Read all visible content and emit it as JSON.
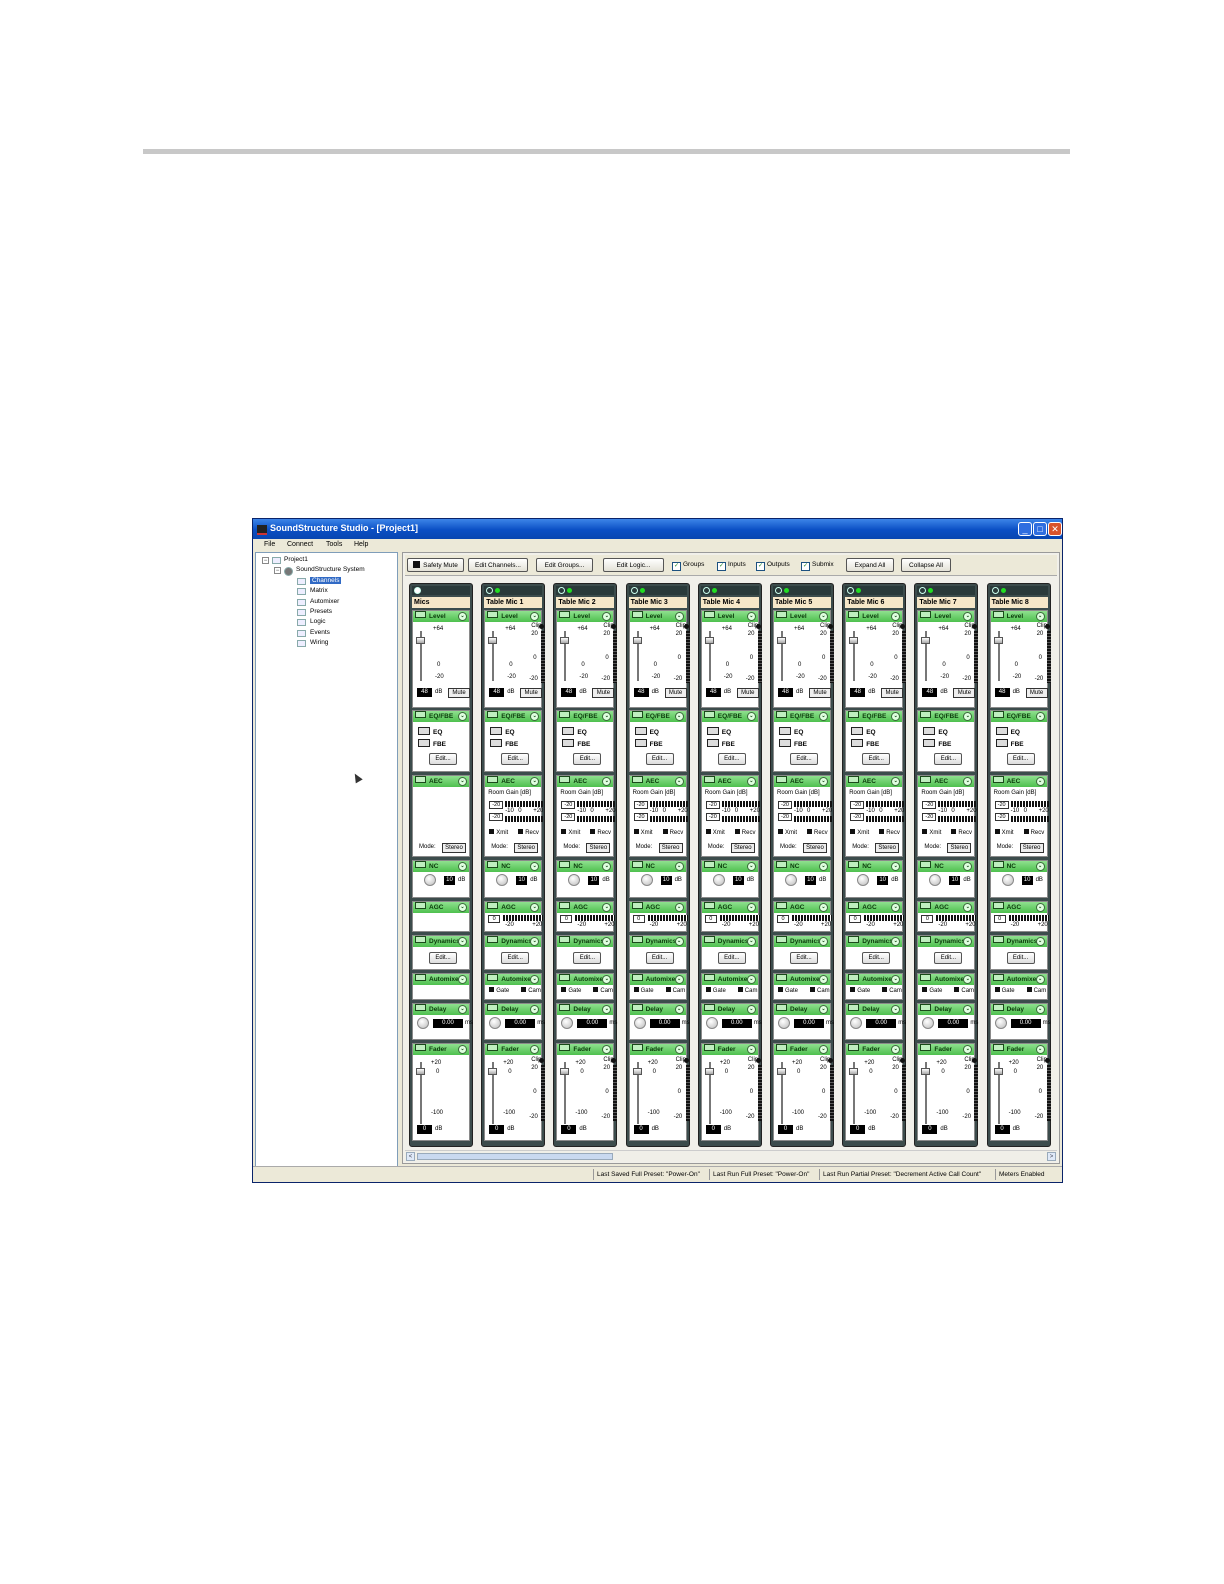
{
  "window": {
    "title": "SoundStructure Studio - [Project1]",
    "minimize": "_",
    "maximize": "□",
    "close": "✕"
  },
  "menu": [
    "File",
    "Connect",
    "Tools",
    "Help"
  ],
  "tree": {
    "project": "Project1",
    "system": "SoundStructure System",
    "items": [
      "Channels",
      "Matrix",
      "Automixer",
      "Presets",
      "Logic",
      "Events",
      "Wiring"
    ],
    "selected": "Channels"
  },
  "toolbar": {
    "safety_mute": "Safety Mute",
    "edit_channels": "Edit Channels...",
    "edit_groups": "Edit Groups...",
    "edit_logic": "Edit Logic...",
    "checks": [
      {
        "label": "Groups",
        "checked": true
      },
      {
        "label": "Inputs",
        "checked": true
      },
      {
        "label": "Outputs",
        "checked": true
      },
      {
        "label": "Submix",
        "checked": true
      }
    ],
    "expand_all": "Expand All",
    "collapse_all": "Collapse All"
  },
  "labels": {
    "level": "Level",
    "eqfbe": "EQ/FBE",
    "eq": "EQ",
    "fbe": "FBE",
    "edit": "Edit...",
    "aec": "AEC",
    "room_gain": "Room Gain [dB]",
    "xmit": "Xmit",
    "recv": "Recv",
    "mode": "Mode:",
    "mode_value": "Stereo",
    "nc": "NC",
    "agc": "AGC",
    "dynamics": "Dynamics",
    "automixer": "Automixer",
    "gate": "Gate",
    "cam": "Cam",
    "delay": "Delay",
    "fader": "Fader",
    "db": "dB",
    "ms": "ms",
    "mute": "Mute",
    "clip": "Clip",
    "lvl_ticks": [
      "+64",
      "0",
      "-20"
    ],
    "meter_ticks": [
      "20",
      "0",
      "-20"
    ],
    "aec_ticks": [
      "-10",
      "0",
      "+20"
    ],
    "aec_box": "-20",
    "agc_box": "0",
    "agc_ticks": [
      "-20",
      "+20"
    ],
    "fader_ticks": [
      "+20",
      "0",
      "-100"
    ],
    "level_value": "48",
    "nc_value": "10",
    "delay_value": "0.00",
    "fader_value": "0"
  },
  "channels": [
    {
      "name": "Mics",
      "type": "group"
    },
    {
      "name": "Table Mic 1",
      "type": "channel"
    },
    {
      "name": "Table Mic 2",
      "type": "channel"
    },
    {
      "name": "Table Mic 3",
      "type": "channel"
    },
    {
      "name": "Table Mic 4",
      "type": "channel"
    },
    {
      "name": "Table Mic 5",
      "type": "channel"
    },
    {
      "name": "Table Mic 6",
      "type": "channel"
    },
    {
      "name": "Table Mic 7",
      "type": "channel"
    },
    {
      "name": "Table Mic 8",
      "type": "channel"
    }
  ],
  "status": [
    "Last Saved Full Preset: \"Power-On\"",
    "Last Run Full Preset: \"Power-On\"",
    "Last Run Partial Preset: \"Decrement Active Call Count\"",
    "Meters Enabled"
  ],
  "colors": {
    "section_header": "#4ec04e",
    "strip_frame": "#3c4c4c",
    "name_bg": "#f6e7c8",
    "selection": "#316ac5"
  }
}
